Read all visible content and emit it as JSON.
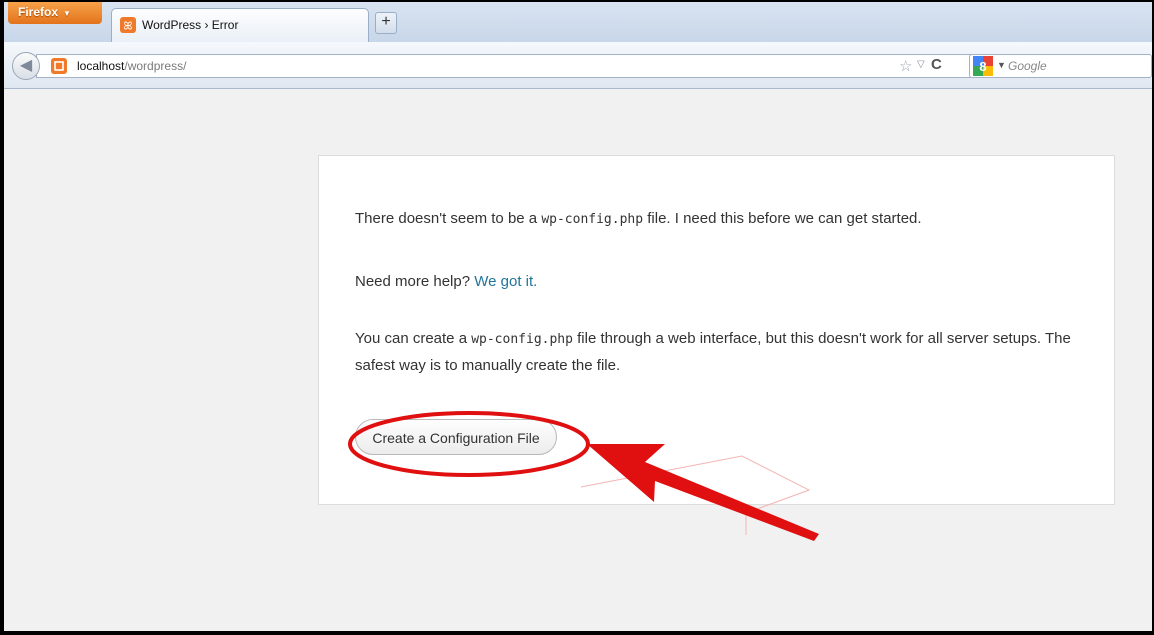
{
  "browser": {
    "menu_button": "Firefox",
    "tab_title": "WordPress › Error",
    "new_tab": "+",
    "url_host": "localhost",
    "url_path": "/wordpress/",
    "search_placeholder": "Google"
  },
  "page": {
    "p1_before": "There doesn't seem to be a ",
    "p1_code": "wp-config.php",
    "p1_after": " file. I need this before we can get started.",
    "p2_before": "Need more help? ",
    "p2_link": "We got it.",
    "p3_before": "You can create a ",
    "p3_code": "wp-config.php",
    "p3_after": " file through a web interface, but this doesn't work for all server setups. The safest way is to manually create the file.",
    "button_label": "Create a Configuration File"
  },
  "colors": {
    "link": "#21759b",
    "annotation": "#e01010",
    "firefox_button": "#e3731a"
  },
  "icons": [
    "xampp-favicon",
    "back-arrow-icon",
    "star-icon",
    "reload-icon",
    "google-icon",
    "dropdown-icon"
  ]
}
